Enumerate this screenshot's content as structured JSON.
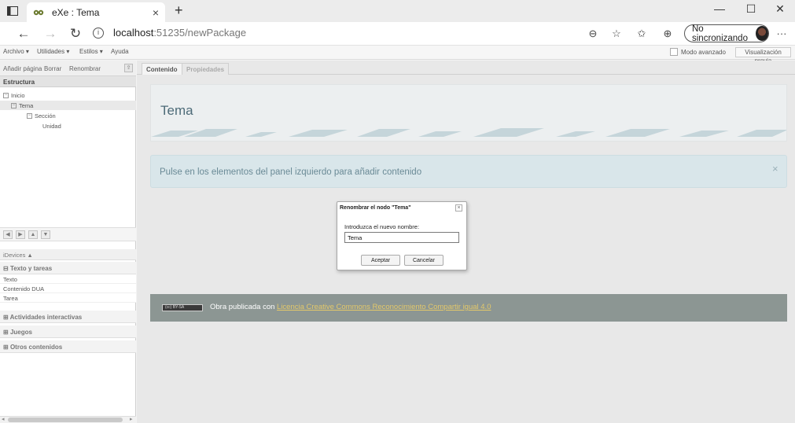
{
  "browser": {
    "tab_title": "eXe : Tema",
    "new_tab": "+",
    "close_tab": "×",
    "url_host": "localhost",
    "url_path": ":51235/newPackage",
    "sync_label": "No sincronizando",
    "window_controls": [
      "—",
      "☐",
      "✕"
    ]
  },
  "menubar": {
    "items": [
      "Archivo ▾",
      "Utilidades ▾",
      "Estilos ▾",
      "Ayuda"
    ],
    "advanced_mode": "Modo avanzado",
    "preview": "Visualización previa"
  },
  "structure": {
    "toolbar": [
      "Añadir página",
      "Borrar",
      "Renombrar"
    ],
    "heading": "Estructura",
    "tree": [
      {
        "label": "Inicio",
        "level": 0,
        "icon": "minus"
      },
      {
        "label": "Tema",
        "level": 1,
        "icon": "minus",
        "selected": true
      },
      {
        "label": "Sección",
        "level": 2,
        "icon": "minus"
      },
      {
        "label": "Unidad",
        "level": 3,
        "icon": "none"
      }
    ]
  },
  "idevices": {
    "heading": "iDevices ▲",
    "categories": [
      {
        "label": "Texto y tareas",
        "expanded": true,
        "items": [
          "Texto",
          "Contenido DUA",
          "Tarea"
        ]
      },
      {
        "label": "Actividades interactivas",
        "expanded": false,
        "items": []
      },
      {
        "label": "Juegos",
        "expanded": false,
        "items": []
      },
      {
        "label": "Otros contenidos",
        "expanded": false,
        "items": []
      }
    ]
  },
  "main": {
    "tabs": [
      {
        "label": "Contenido",
        "active": true
      },
      {
        "label": "Propiedades",
        "active": false
      }
    ],
    "page_title": "Tema",
    "notice": "Pulse en los elementos del panel izquierdo para añadir contenido",
    "notice_close": "×",
    "footer_prefix": "Obra publicada con ",
    "footer_link": "Licencia Creative Commons Reconocimiento Compartir igual 4.0",
    "cc_badge": "(cc) BY-SA"
  },
  "dialog": {
    "title": "Renombrar el nodo \"Tema\"",
    "close": "×",
    "label": "Introduzca el nuevo nombre:",
    "value": "Tema",
    "accept": "Aceptar",
    "cancel": "Cancelar"
  },
  "colors": {
    "banner_title": "#4d6b78",
    "notice_bg": "#d9e6ea",
    "footer_bg": "#8c9693",
    "link": "#e3c86a"
  }
}
